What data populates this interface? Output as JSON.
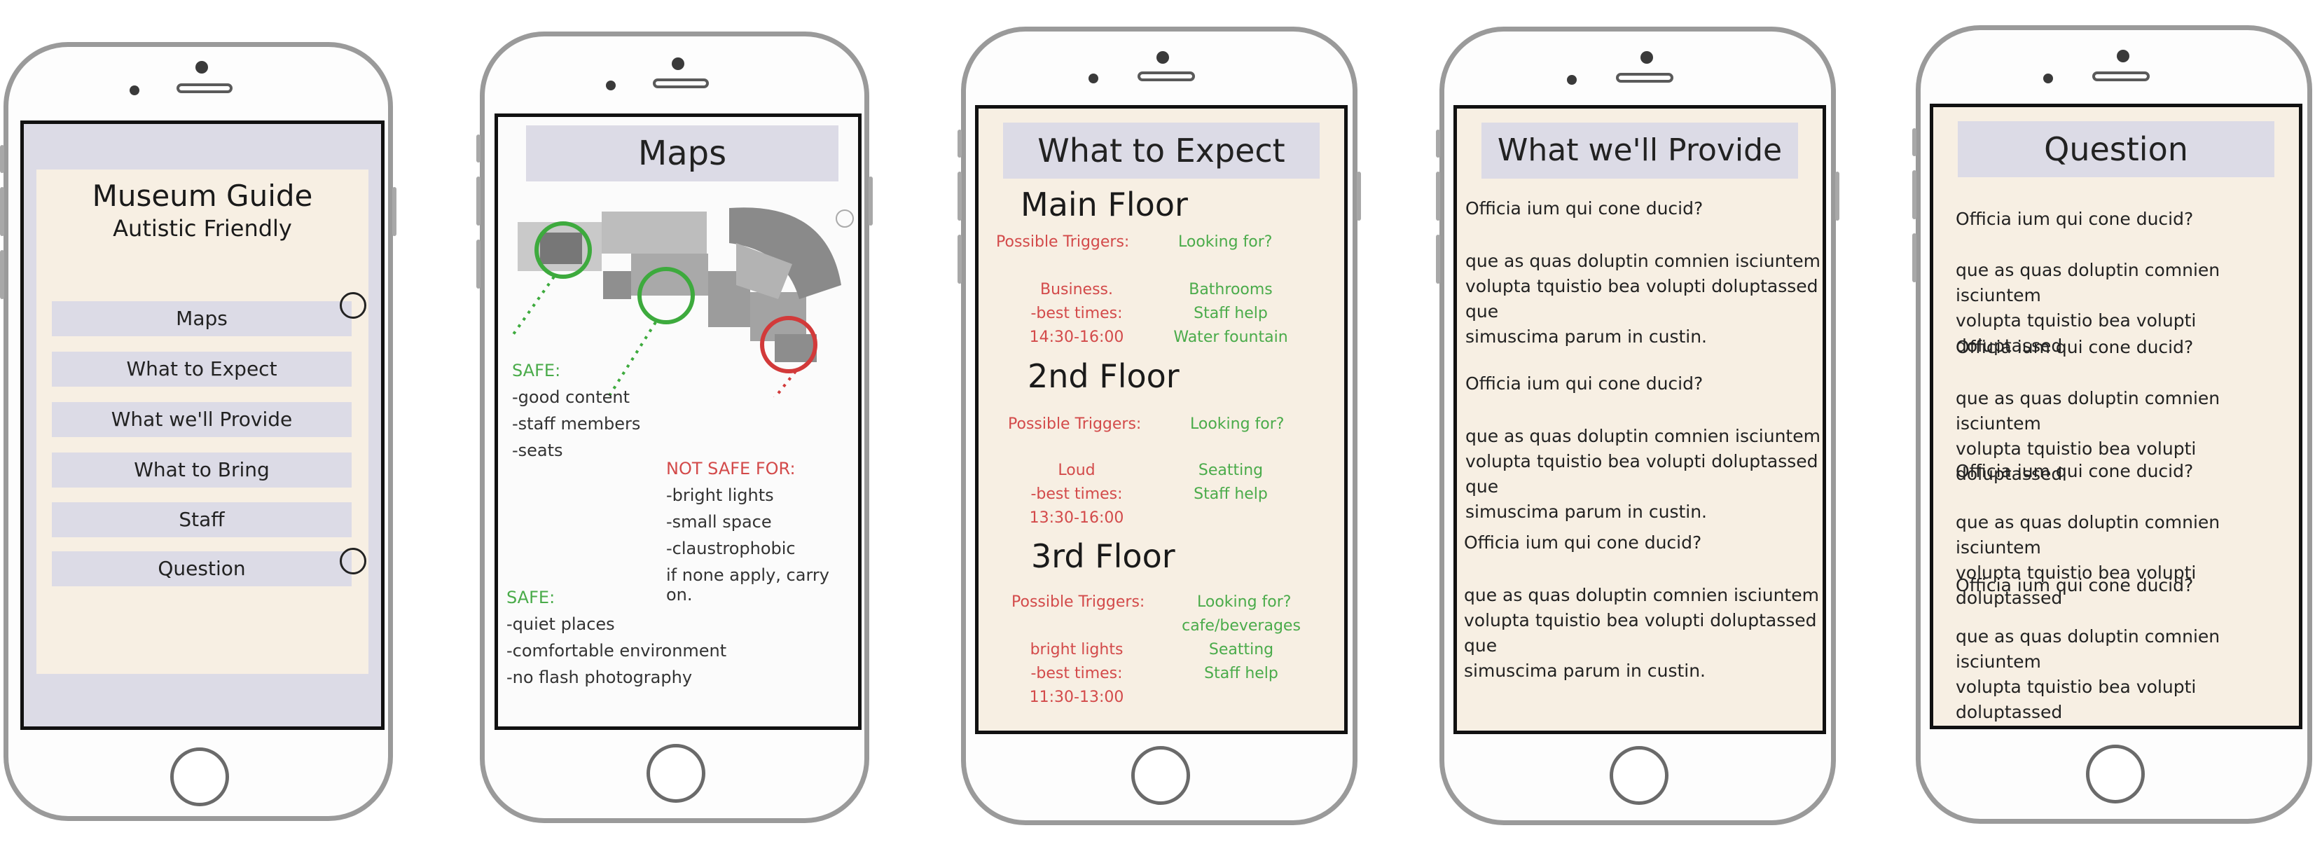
{
  "phone1": {
    "title": "Museum Guide",
    "subtitle": "Autistic Friendly",
    "menu": [
      {
        "label": "Maps"
      },
      {
        "label": "What to Expect"
      },
      {
        "label": "What we'll Provide"
      },
      {
        "label": "What to Bring"
      },
      {
        "label": "Staff"
      },
      {
        "label": "Question"
      }
    ]
  },
  "phone2": {
    "title": "Maps",
    "safe1_head": "SAFE:",
    "safe1_items": [
      "-good content",
      "-staff members",
      "-seats"
    ],
    "notsafe_head": "NOT SAFE FOR:",
    "notsafe_items": [
      "-bright lights",
      "-small space",
      "-claustrophobic",
      "if none apply, carry on."
    ],
    "safe2_head": "SAFE:",
    "safe2_items": [
      "-quiet places",
      "-comfortable environment",
      "-no flash photography"
    ]
  },
  "phone3": {
    "title": "What to Expect",
    "floors": [
      {
        "name": "Main Floor",
        "triggers_label": "Possible Triggers:",
        "looking_label": "Looking for?",
        "triggers": [
          "Business.",
          "-best times:",
          "14:30-16:00"
        ],
        "looking": [
          "Bathrooms",
          "Staff help",
          "Water fountain"
        ]
      },
      {
        "name": "2nd Floor",
        "triggers_label": "Possible Triggers:",
        "looking_label": "Looking for?",
        "triggers": [
          "Loud",
          "-best times:",
          "13:30-16:00"
        ],
        "looking": [
          "Seatting",
          "Staff help"
        ]
      },
      {
        "name": "3rd Floor",
        "triggers_label": "Possible Triggers:",
        "looking_label": "Looking for?",
        "triggers": [
          "bright lights",
          "-best times:",
          "11:30-13:00"
        ],
        "looking": [
          "cafe/beverages",
          "Seatting",
          "Staff help"
        ]
      }
    ]
  },
  "phone4": {
    "title": "What we'll Provide",
    "items": [
      {
        "q": "Officia ium qui cone ducid?",
        "a1": " que as quas doluptin comnien isciuntem",
        "a2": "volupta tquistio bea volupti doluptassed que",
        "a3": "simuscima parum in custin."
      },
      {
        "q": "Officia ium qui cone ducid?",
        "a1": " que as quas doluptin comnien isciuntem",
        "a2": "volupta tquistio bea volupti doluptassed que",
        "a3": "simuscima parum in custin."
      },
      {
        "q": "Officia ium qui cone ducid?",
        "a1": " que as quas doluptin comnien isciuntem",
        "a2": "volupta tquistio bea volupti doluptassed que",
        "a3": "simuscima parum in custin."
      }
    ]
  },
  "phone5": {
    "title": "Question",
    "items": [
      {
        "q": "Officia ium qui cone ducid?",
        "a1": " que as quas doluptin comnien isciuntem",
        "a2": "volupta tquistio bea volupti doluptassed"
      },
      {
        "q": "Officia ium qui cone ducid?",
        "a1": " que as quas doluptin comnien isciuntem",
        "a2": "volupta tquistio bea volupti doluptassed"
      },
      {
        "q": "Officia ium qui cone ducid?",
        "a1": " que as quas doluptin comnien isciuntem",
        "a2": "volupta tquistio bea volupti doluptassed"
      },
      {
        "q": "Officia ium qui cone ducid?",
        "a1": " que as quas doluptin comnien isciuntem",
        "a2": "volupta tquistio bea volupti doluptassed"
      }
    ]
  },
  "colors": {
    "title_bg": "#dcdbe6",
    "screen_cream": "#f7efe3",
    "trigger_red": "#d34a4a",
    "safe_green": "#4aab4a"
  }
}
